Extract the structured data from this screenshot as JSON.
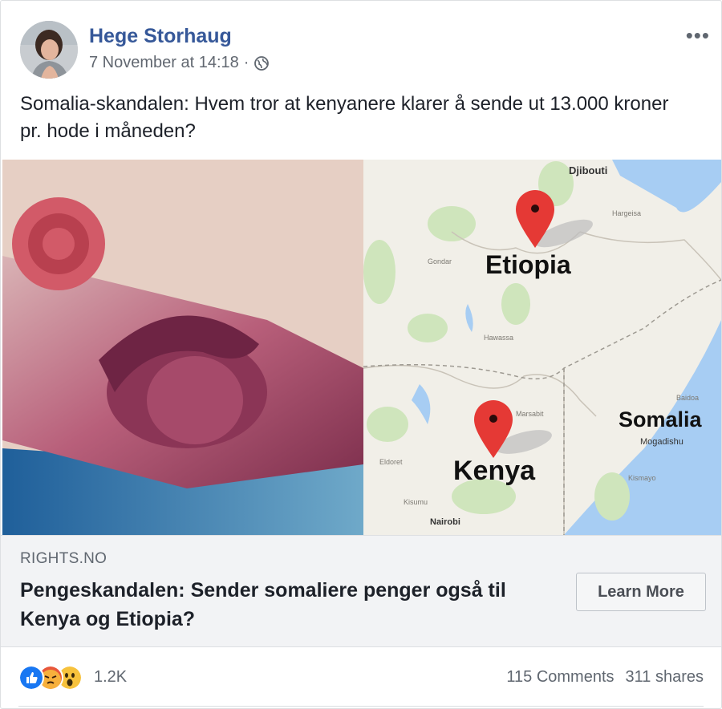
{
  "post": {
    "author": "Hege Storhaug",
    "timestamp": "7 November at 14:18",
    "separator": "·",
    "audience_icon": "globe-icon",
    "options_label": "•••",
    "text": "Somalia-skandalen: Hvem tror at kenyanere klarer å sende ut 13.000 kroner pr. hode i måneden?"
  },
  "media": {
    "map_labels": {
      "djibouti": "Djibouti",
      "etiopia": "Etiopia",
      "somalia": "Somalia",
      "mogadishu": "Mogadishu",
      "kenya": "Kenya",
      "nairobi": "Nairobi"
    }
  },
  "link": {
    "domain": "RIGHTS.NO",
    "title": "Pengeskandalen: Sender somaliere penger også til Kenya og Etiopia?",
    "cta_label": "Learn More"
  },
  "footer": {
    "reaction_icons": [
      "like-icon",
      "angry-icon",
      "wow-icon"
    ],
    "reaction_count": "1.2K",
    "comments": "115 Comments",
    "shares": "311 shares"
  },
  "colors": {
    "name_link": "#365899",
    "pin": "#e53935",
    "sea": "#a7cdf3",
    "land": "#f1efe8"
  }
}
